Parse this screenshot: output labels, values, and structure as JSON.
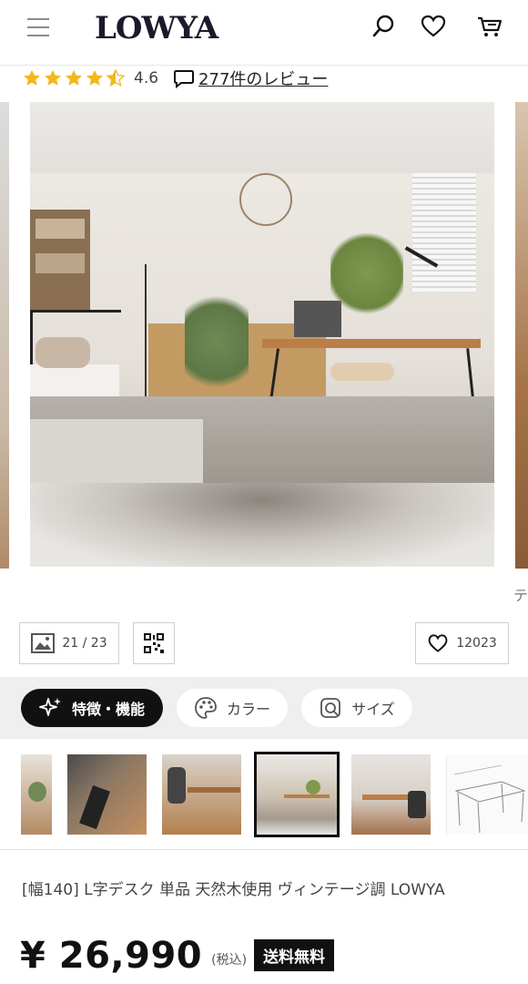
{
  "header": {
    "logo": "LOWYA",
    "icons": [
      "menu-icon",
      "search-icon",
      "heart-icon",
      "cart-icon"
    ]
  },
  "rating": {
    "stars": 4.6,
    "value": "4.6",
    "review_link": "277件のレビュー"
  },
  "carousel": {
    "next_hint": "テ"
  },
  "image_counter": {
    "text": "21 / 23"
  },
  "favorite": {
    "count": "12023"
  },
  "tabs": [
    {
      "label": "特徴・機能",
      "icon": "sparkle-icon",
      "active": true
    },
    {
      "label": "カラー",
      "icon": "palette-icon",
      "active": false
    },
    {
      "label": "サイズ",
      "icon": "size-icon",
      "active": false
    }
  ],
  "thumbnails": {
    "count": 6,
    "selected_index": 3
  },
  "product": {
    "title": "[幅140] L字デスク 単品 天然木使用 ヴィンテージ調  LOWYA",
    "price": "¥ 26,990",
    "tax_note": "(税込)",
    "shipping_badge": "送料無料"
  },
  "colors": {
    "star": "#f2b81c",
    "active_tab": "#111111"
  }
}
